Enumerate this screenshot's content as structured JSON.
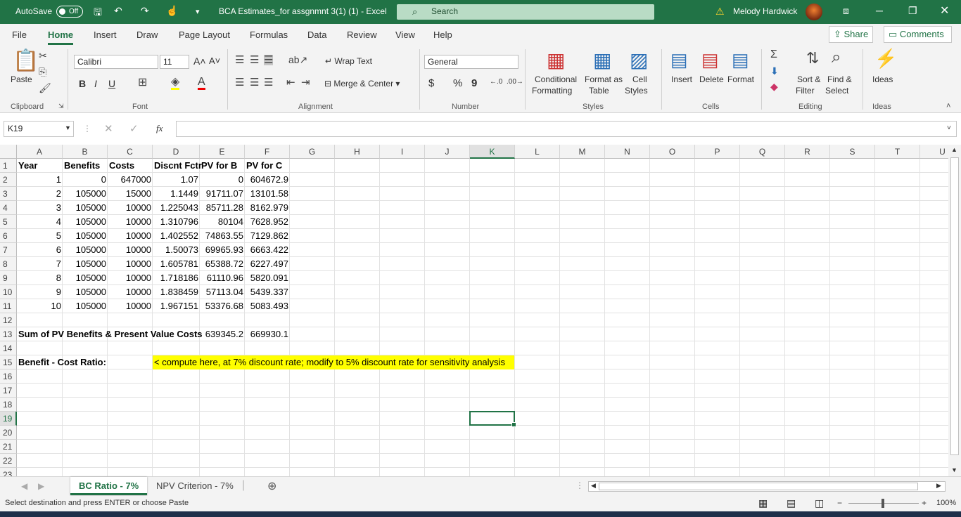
{
  "title_bar": {
    "autosave_label": "AutoSave",
    "autosave_state": "Off",
    "document_title": "BCA Estimates_for assgnmnt 3(1) (1)  -  Excel",
    "search_placeholder": "Search",
    "user_name": "Melody Hardwick"
  },
  "menu": {
    "tabs": [
      "File",
      "Home",
      "Insert",
      "Draw",
      "Page Layout",
      "Formulas",
      "Data",
      "Review",
      "View",
      "Help"
    ],
    "active_tab": "Home",
    "share_label": "Share",
    "comments_label": "Comments"
  },
  "ribbon": {
    "clipboard": {
      "paste": "Paste",
      "group": "Clipboard"
    },
    "font": {
      "name": "Calibri",
      "size": "11",
      "group": "Font",
      "bold": "B",
      "italic": "I",
      "underline": "U"
    },
    "alignment": {
      "wrap_text": "Wrap Text",
      "merge_center": "Merge & Center",
      "group": "Alignment"
    },
    "number": {
      "format": "General",
      "currency": "$",
      "percent": "%",
      "comma": "9",
      "group": "Number"
    },
    "styles": {
      "conditional": "Conditional",
      "conditional2": "Formatting",
      "format_table": "Format as",
      "format_table2": "Table",
      "cell_styles": "Cell",
      "cell_styles2": "Styles",
      "group": "Styles"
    },
    "cells": {
      "insert": "Insert",
      "delete": "Delete",
      "format": "Format",
      "group": "Cells"
    },
    "editing": {
      "sort_filter": "Sort &",
      "sort_filter2": "Filter",
      "find_select": "Find &",
      "find_select2": "Select",
      "group": "Editing"
    },
    "ideas": {
      "label": "Ideas",
      "group": "Ideas"
    }
  },
  "formula_bar": {
    "name_box": "K19",
    "fx": "fx",
    "formula": ""
  },
  "sheet": {
    "columns": [
      "A",
      "B",
      "C",
      "D",
      "E",
      "F",
      "G",
      "H",
      "I",
      "J",
      "K",
      "L",
      "M",
      "N",
      "O",
      "P",
      "Q",
      "R",
      "S",
      "T",
      "U"
    ],
    "selected_column": "K",
    "selected_row": "19",
    "rows": [
      "1",
      "2",
      "3",
      "4",
      "5",
      "6",
      "7",
      "8",
      "9",
      "10",
      "11",
      "12",
      "13",
      "14",
      "15",
      "16",
      "17",
      "18",
      "19",
      "20",
      "21",
      "22",
      "23"
    ],
    "headers": {
      "A": "Year",
      "B": "Benefits",
      "C": "Costs",
      "D": "Discnt Fctr",
      "E": "PV for B",
      "F": "PV for C"
    },
    "data": [
      [
        "1",
        "0",
        "647000",
        "1.07",
        "0",
        "604672.9"
      ],
      [
        "2",
        "105000",
        "15000",
        "1.1449",
        "91711.07",
        "13101.58"
      ],
      [
        "3",
        "105000",
        "10000",
        "1.225043",
        "85711.28",
        "8162.979"
      ],
      [
        "4",
        "105000",
        "10000",
        "1.310796",
        "80104",
        "7628.952"
      ],
      [
        "5",
        "105000",
        "10000",
        "1.402552",
        "74863.55",
        "7129.862"
      ],
      [
        "6",
        "105000",
        "10000",
        "1.50073",
        "69965.93",
        "6663.422"
      ],
      [
        "7",
        "105000",
        "10000",
        "1.605781",
        "65388.72",
        "6227.497"
      ],
      [
        "8",
        "105000",
        "10000",
        "1.718186",
        "61110.96",
        "5820.091"
      ],
      [
        "9",
        "105000",
        "10000",
        "1.838459",
        "57113.04",
        "5439.337"
      ],
      [
        "10",
        "105000",
        "10000",
        "1.967151",
        "53376.68",
        "5083.493"
      ]
    ],
    "sum_label": "Sum of PV Benefits & Present Value Costs",
    "sum_pv_benefits": "639345.2",
    "sum_pv_costs": "669930.1",
    "ratio_label": "Benefit - Cost Ratio:",
    "note": "< compute here, at 7% discount rate; modify to 5% discount rate for sensitivity analysis",
    "note_color": "#ffff00"
  },
  "sheet_tabs": {
    "tabs": [
      "BC Ratio - 7%",
      "NPV Criterion - 7%"
    ],
    "active": "BC Ratio - 7%"
  },
  "status_bar": {
    "message": "Select destination and press ENTER or choose Paste",
    "zoom": "100%"
  }
}
